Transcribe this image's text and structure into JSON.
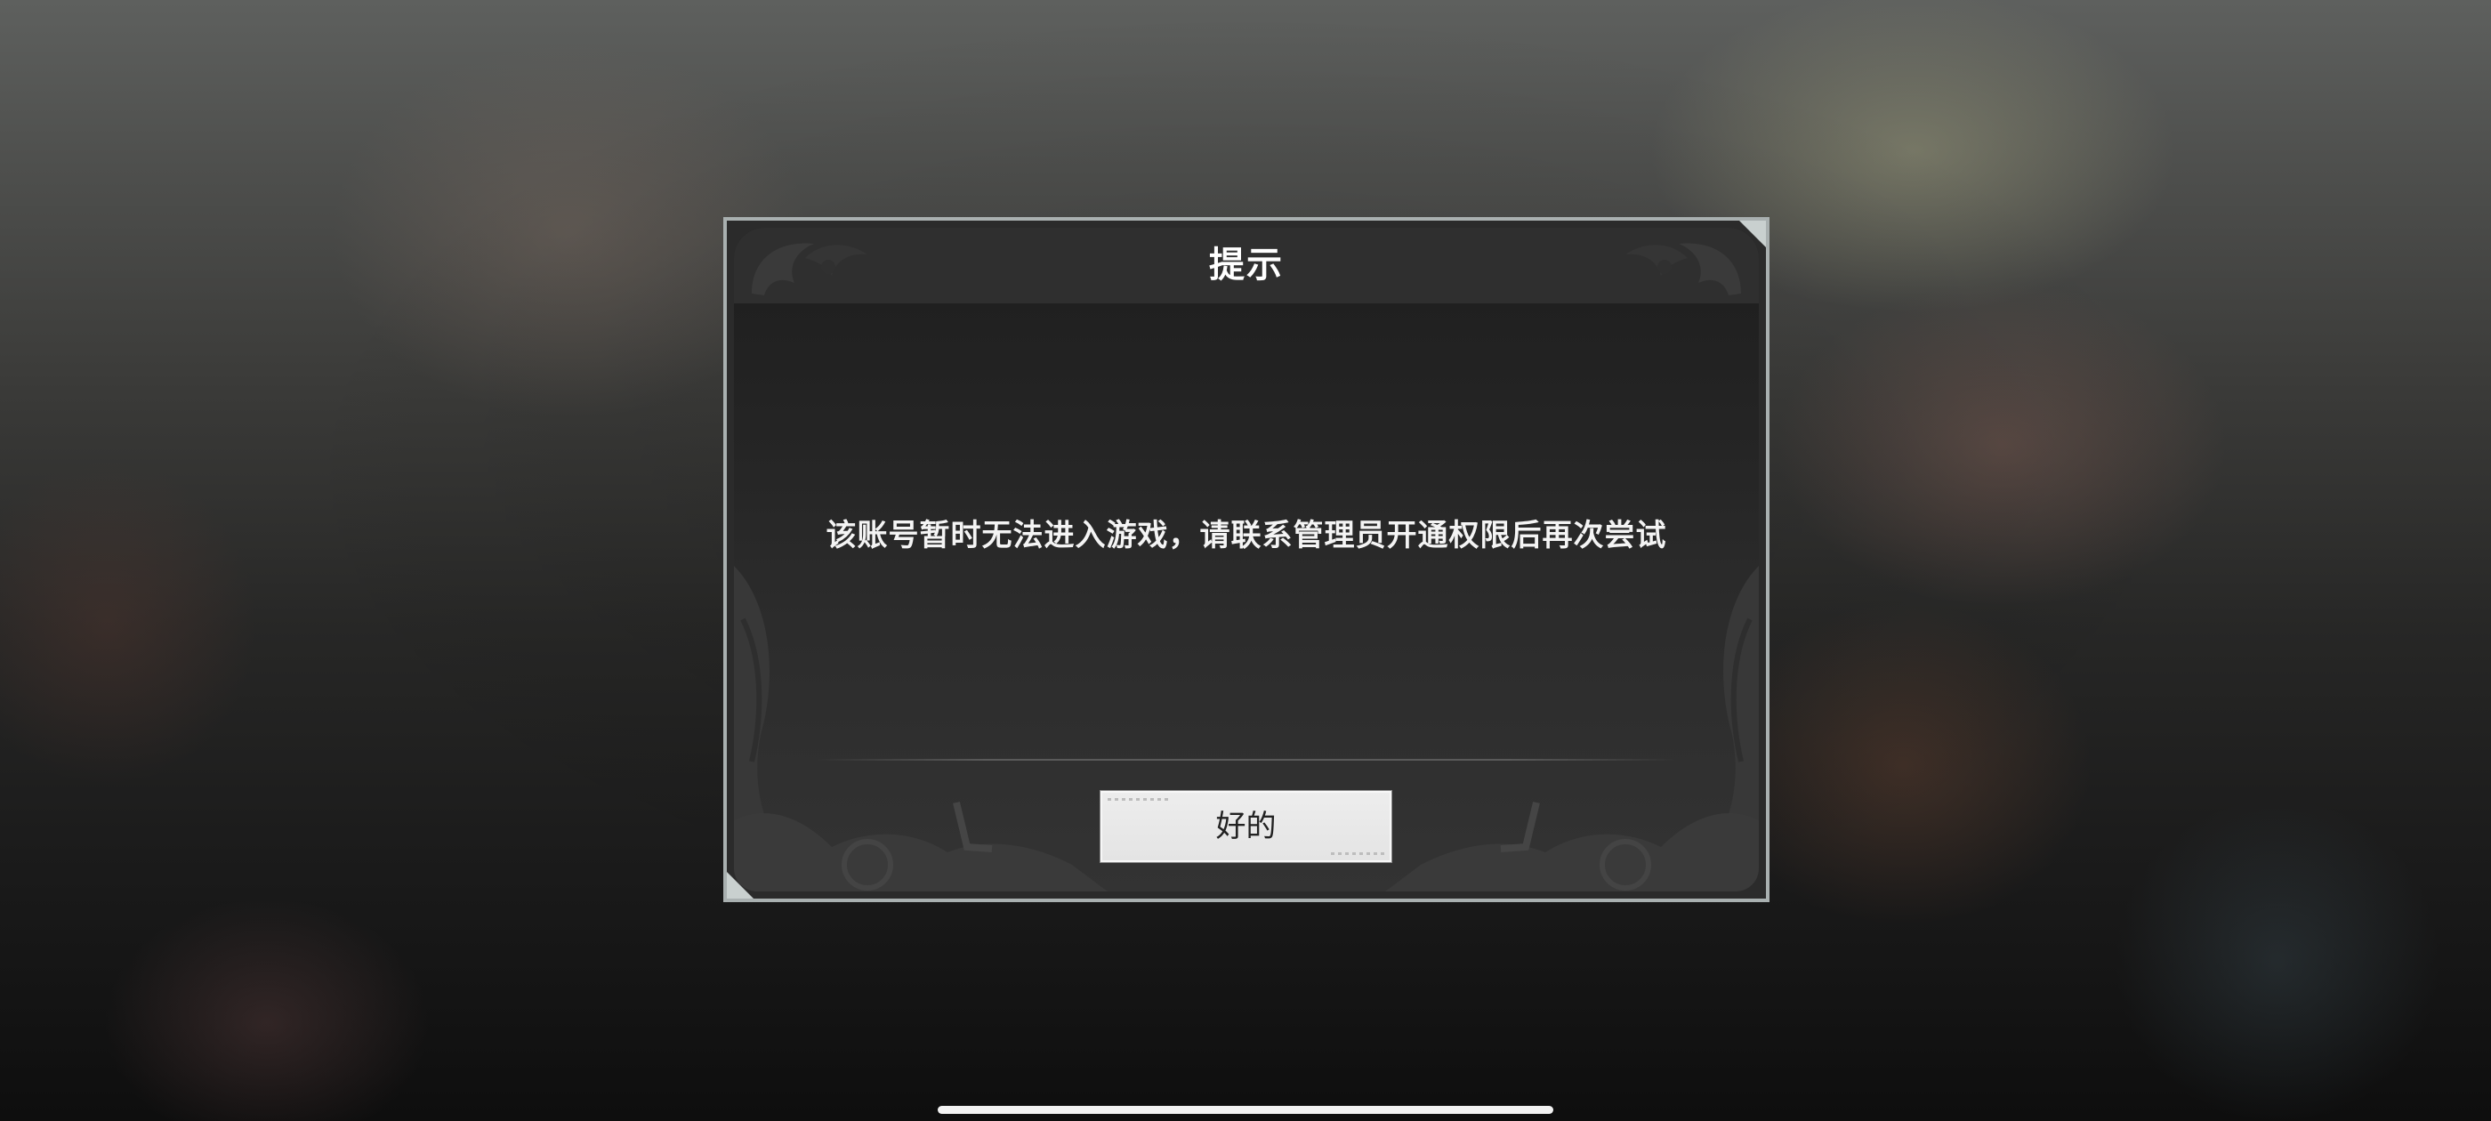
{
  "dialog": {
    "title": "提示",
    "message": "该账号暂时无法进入游戏，请联系管理员开通权限后再次尝试",
    "confirm_label": "好的"
  },
  "colors": {
    "dialog_border": "#a9b0b0",
    "dialog_background": "#2b2b2b",
    "title_text": "#ffffff",
    "message_text": "#f4f4f4",
    "button_background": "#e8e8e8",
    "button_text": "#222222",
    "home_indicator": "#f2f2f2"
  },
  "icons": [
    "corner-accent-icon",
    "ornament-icon"
  ]
}
